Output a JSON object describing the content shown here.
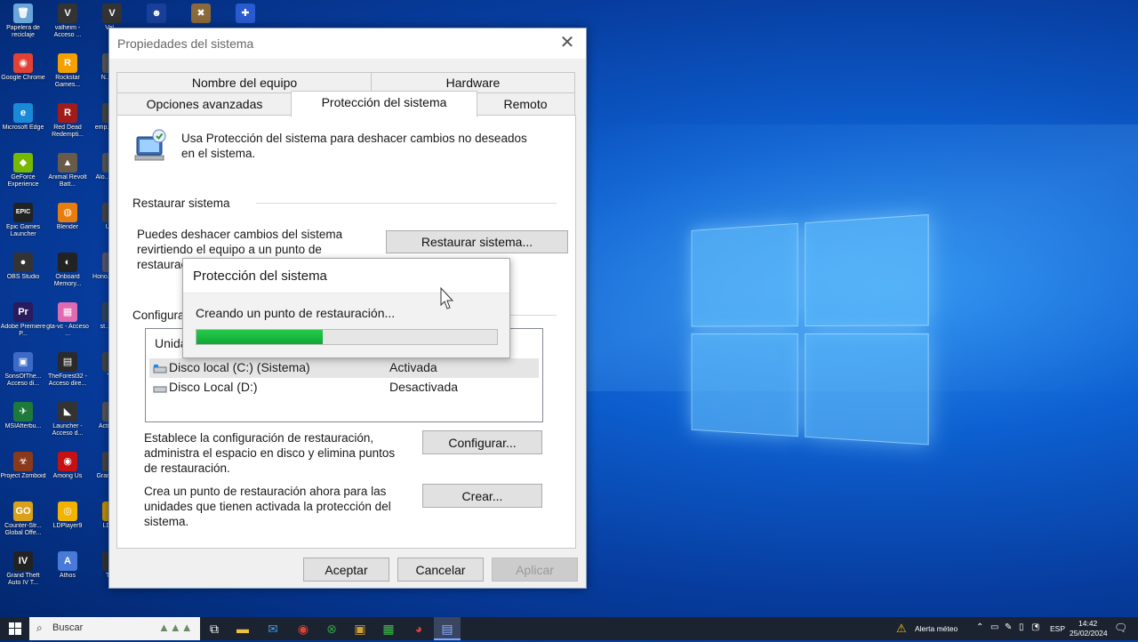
{
  "desktop_icons": [
    {
      "label": "Papelera de reciclaje",
      "glyph": "🗑",
      "color": "#6aa7d8"
    },
    {
      "label": "Google Chrome",
      "glyph": "◉",
      "color": "#e34133"
    },
    {
      "label": "Microsoft Edge",
      "glyph": "e",
      "color": "#1b8ad6"
    },
    {
      "label": "GeForce Experience",
      "glyph": "◆",
      "color": "#76b900"
    },
    {
      "label": "Epic Games Launcher",
      "glyph": "EPIC",
      "color": "#222"
    },
    {
      "label": "OBS Studio",
      "glyph": "●",
      "color": "#333"
    },
    {
      "label": "Adobe Premiere P...",
      "glyph": "Pr",
      "color": "#2a1a5e"
    },
    {
      "label": "SonsOfThe... Acceso di...",
      "glyph": "▣",
      "color": "#3d6ac7"
    },
    {
      "label": "MSIAfterbu...",
      "glyph": "✈",
      "color": "#1e7a3a"
    },
    {
      "label": "Project Zomboid",
      "glyph": "☣",
      "color": "#8a3a1a"
    },
    {
      "label": "Counter-Str... Global Offe...",
      "glyph": "GO",
      "color": "#d9a01a"
    },
    {
      "label": "Grand Theft Auto IV T...",
      "glyph": "IV",
      "color": "#222"
    },
    {
      "label": "valheim - Acceso ...",
      "glyph": "V",
      "color": "#333"
    },
    {
      "label": "Rockstar Games...",
      "glyph": "R",
      "color": "#f5a000"
    },
    {
      "label": "Red Dead Redempti...",
      "glyph": "R",
      "color": "#a21b1b"
    },
    {
      "label": "Animal Revolt Batt...",
      "glyph": "▲",
      "color": "#6a5a4a"
    },
    {
      "label": "Blender",
      "glyph": "◍",
      "color": "#e87d0d"
    },
    {
      "label": "Onboard Memory...",
      "glyph": "◐",
      "color": "#222"
    },
    {
      "label": "gta-vc - Acceso ...",
      "glyph": "▦",
      "color": "#e06ab0"
    },
    {
      "label": "TheForest32 - Acceso dire...",
      "glyph": "▤",
      "color": "#2a2a2a"
    },
    {
      "label": "Launcher - Acceso d...",
      "glyph": "◣",
      "color": "#333"
    },
    {
      "label": "Among Us",
      "glyph": "◉",
      "color": "#c51111"
    },
    {
      "label": "LDPlayer9",
      "glyph": "◎",
      "color": "#f1b300"
    },
    {
      "label": "Athos",
      "glyph": "A",
      "color": "#4a7ad8"
    },
    {
      "label": "Val...",
      "glyph": "V",
      "color": "#333"
    },
    {
      "label": "N... Al...",
      "glyph": "N",
      "color": "#555"
    },
    {
      "label": "emp... Acc...",
      "glyph": "E",
      "color": "#444"
    },
    {
      "label": "Alo... Gan...",
      "glyph": "A",
      "color": "#555"
    },
    {
      "label": "Un...",
      "glyph": "U",
      "color": "#444"
    },
    {
      "label": "Hono... Daw...",
      "glyph": "H",
      "color": "#556"
    },
    {
      "label": "st... Ac...",
      "glyph": "S",
      "color": "#345"
    },
    {
      "label": "Tl...",
      "glyph": "T",
      "color": "#444"
    },
    {
      "label": "Acti... C...",
      "glyph": "A",
      "color": "#555"
    },
    {
      "label": "Gran... Al...",
      "glyph": "G",
      "color": "#444"
    },
    {
      "label": "LDM...",
      "glyph": "L",
      "color": "#c09000"
    },
    {
      "label": "Th...",
      "glyph": "T",
      "color": "#333"
    },
    {
      "label": "",
      "glyph": "☻",
      "color": "#1a3f9a"
    },
    {
      "label": "",
      "glyph": "✖",
      "color": "#8a6a3a"
    },
    {
      "label": "",
      "glyph": "✚",
      "color": "#2a5ad0"
    }
  ],
  "dialog": {
    "title": "Propiedades del sistema",
    "tabs": {
      "nombre_equipo": "Nombre del equipo",
      "hardware": "Hardware",
      "opciones_avanzadas": "Opciones avanzadas",
      "proteccion": "Protección del sistema",
      "remoto": "Remoto"
    },
    "intro_line1": "Usa Protección del sistema para deshacer cambios no deseados",
    "intro_line2": "en el sistema.",
    "restore_section": "Restaurar sistema",
    "restore_desc_line1": "Puedes deshacer cambios del sistema",
    "restore_desc_line2": "revirtiendo el equipo a un punto de",
    "restore_desc_line3": "restauración",
    "restore_button": "Restaurar sistema...",
    "config_section": "Configuración de protección",
    "list_header_drive": "Unidades disponibles",
    "drives": [
      {
        "name": "Disco local (C:) (Sistema)",
        "status": "Activada"
      },
      {
        "name": "Disco Local (D:)",
        "status": "Desactivada"
      }
    ],
    "configure_desc_line1": "Establece la configuración de restauración,",
    "configure_desc_line2": "administra el espacio en disco y elimina puntos",
    "configure_desc_line3": "de restauración.",
    "configure_button": "Configurar...",
    "create_desc_line1": "Crea un punto de restauración ahora para las",
    "create_desc_line2": "unidades que tienen activada la protección del",
    "create_desc_line3": "sistema.",
    "create_button": "Crear...",
    "accept_button": "Aceptar",
    "cancel_button": "Cancelar",
    "apply_button": "Aplicar"
  },
  "popup": {
    "title": "Protección del sistema",
    "message": "Creando un punto de restauración...",
    "progress_percent": 42
  },
  "taskbar": {
    "search_placeholder": "Buscar",
    "weather": "Alerta méteo",
    "language": "ESP",
    "time": "14:42",
    "date": "25/02/2024"
  }
}
